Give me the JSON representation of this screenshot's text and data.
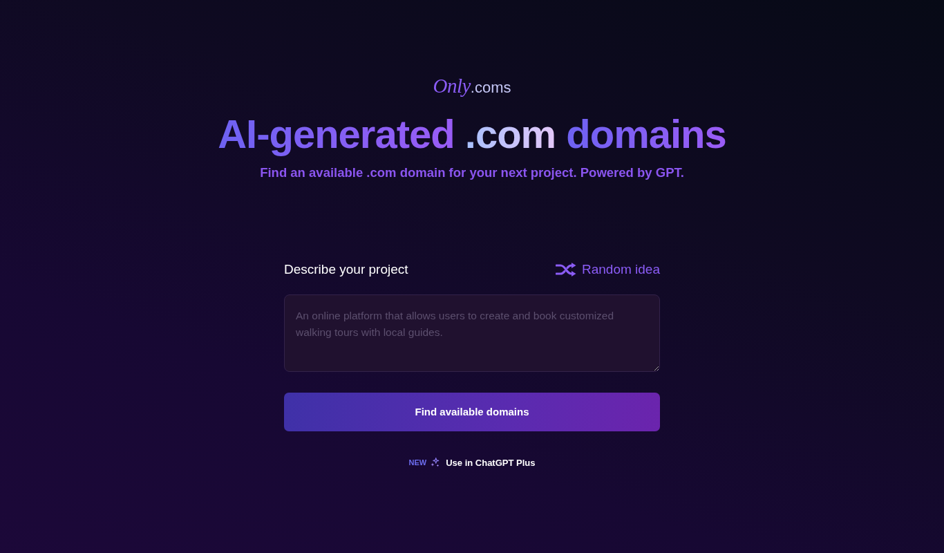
{
  "logo": {
    "parts": [
      {
        "text": "Only",
        "kind": "script"
      },
      {
        "text": ".coms",
        "kind": "plain"
      }
    ]
  },
  "headline": {
    "parts": [
      {
        "text": "AI-generated",
        "kind": "accent"
      },
      {
        "text": ".com",
        "kind": "highlight"
      },
      {
        "text": "domains",
        "kind": "accent"
      }
    ]
  },
  "subtitle": "Find an available .com domain for your next project. Powered by GPT.",
  "form": {
    "label": "Describe your project",
    "random_button": "Random idea",
    "description": {
      "placeholder": "An online platform that allows users to create and book customized walking tours with local guides."
    },
    "submit_button": "Find available domains"
  },
  "promo": {
    "badge": "NEW",
    "link": "Use in ChatGPT Plus"
  }
}
